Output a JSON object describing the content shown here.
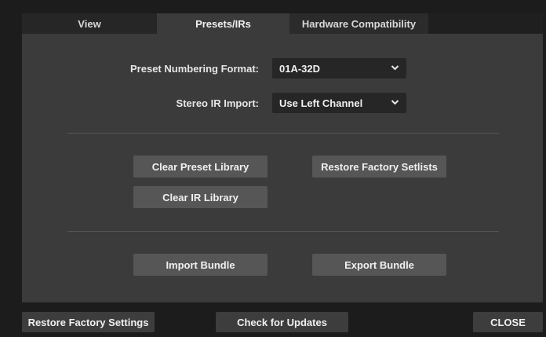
{
  "tabs": {
    "view": "View",
    "presets_irs": "Presets/IRs",
    "hardware_compat": "Hardware Compatibility"
  },
  "active_tab": "Presets/IRs",
  "settings": {
    "preset_numbering_label": "Preset Numbering Format:",
    "preset_numbering_value": "01A-32D",
    "stereo_ir_label": "Stereo IR Import:",
    "stereo_ir_value": "Use Left Channel"
  },
  "buttons": {
    "clear_preset_library": "Clear Preset Library",
    "restore_factory_setlists": "Restore Factory Setlists",
    "clear_ir_library": "Clear IR Library",
    "import_bundle": "Import Bundle",
    "export_bundle": "Export Bundle"
  },
  "footer": {
    "restore_factory_settings": "Restore Factory Settings",
    "check_for_updates": "Check for Updates",
    "close": "CLOSE"
  },
  "icons": {
    "dropdown": "chevron-down-icon"
  },
  "colors": {
    "window_bg": "#1c1c1c",
    "panel_bg": "#3b3b3b",
    "button_bg": "#565656",
    "select_bg": "#262626"
  }
}
